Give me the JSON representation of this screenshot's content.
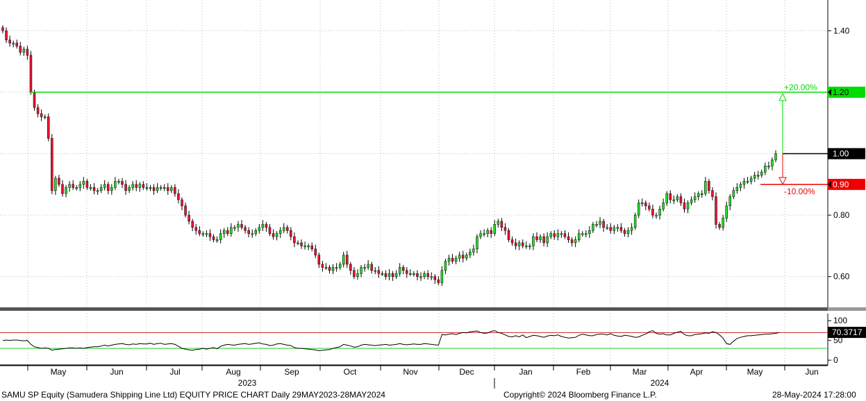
{
  "footer": {
    "left": "SAMU SP Equity (Samudera Shipping Line Ltd) EQUITY PRICE CHART  Daily 29MAY2023-28MAY2024",
    "center": "Copyright© 2024 Bloomberg Finance L.P.",
    "right": "28-May-2024 17:28:00"
  },
  "colors": {
    "up": "#22dd22",
    "down": "#ee1133",
    "target_up": "#00dd00",
    "target_down": "#ee0000",
    "rsi_line": "#000000"
  },
  "chart_data": [
    {
      "type": "candlestick",
      "ylim": [
        0.5,
        1.5
      ],
      "y_ticks": [
        0.6,
        0.8,
        1.0,
        1.2,
        1.4
      ],
      "y_tick_labels": [
        "0.60",
        "0.80",
        "1.00",
        "1.20",
        "1.40"
      ],
      "x_labels": [
        "May",
        "Jun",
        "Jul",
        "Aug",
        "Sep",
        "Oct",
        "Nov",
        "Dec",
        "Jan",
        "Feb",
        "Mar",
        "Apr",
        "May",
        "Jun"
      ],
      "year_labels": [
        "2023",
        "2024"
      ],
      "grid": true,
      "last_price": 1.0,
      "last_price_label": "1.00",
      "upper_target": {
        "value": 1.2,
        "label": "1.20",
        "pct_label": "+20.00%"
      },
      "lower_target": {
        "value": 0.9,
        "label": "0.90",
        "pct_label": "-10.00%"
      },
      "close": [
        1.4,
        1.37,
        1.36,
        1.36,
        1.35,
        1.33,
        1.34,
        1.32,
        1.2,
        1.15,
        1.13,
        1.12,
        1.12,
        1.05,
        0.88,
        0.92,
        0.9,
        0.87,
        0.89,
        0.9,
        0.89,
        0.89,
        0.9,
        0.91,
        0.89,
        0.89,
        0.88,
        0.88,
        0.89,
        0.9,
        0.88,
        0.89,
        0.91,
        0.91,
        0.9,
        0.88,
        0.89,
        0.9,
        0.89,
        0.9,
        0.89,
        0.89,
        0.89,
        0.88,
        0.89,
        0.89,
        0.89,
        0.88,
        0.89,
        0.87,
        0.85,
        0.83,
        0.8,
        0.78,
        0.76,
        0.75,
        0.74,
        0.74,
        0.74,
        0.73,
        0.72,
        0.72,
        0.74,
        0.75,
        0.74,
        0.76,
        0.76,
        0.77,
        0.76,
        0.75,
        0.74,
        0.74,
        0.75,
        0.76,
        0.77,
        0.76,
        0.74,
        0.73,
        0.74,
        0.75,
        0.76,
        0.75,
        0.73,
        0.71,
        0.71,
        0.7,
        0.7,
        0.7,
        0.69,
        0.67,
        0.64,
        0.63,
        0.63,
        0.62,
        0.63,
        0.63,
        0.64,
        0.67,
        0.64,
        0.62,
        0.6,
        0.61,
        0.63,
        0.63,
        0.64,
        0.62,
        0.62,
        0.61,
        0.61,
        0.6,
        0.61,
        0.6,
        0.61,
        0.63,
        0.62,
        0.61,
        0.61,
        0.61,
        0.6,
        0.6,
        0.61,
        0.6,
        0.6,
        0.59,
        0.58,
        0.62,
        0.65,
        0.66,
        0.65,
        0.66,
        0.67,
        0.66,
        0.67,
        0.68,
        0.69,
        0.73,
        0.74,
        0.74,
        0.75,
        0.74,
        0.77,
        0.78,
        0.76,
        0.75,
        0.72,
        0.71,
        0.7,
        0.71,
        0.7,
        0.7,
        0.7,
        0.73,
        0.72,
        0.73,
        0.71,
        0.73,
        0.74,
        0.73,
        0.74,
        0.74,
        0.73,
        0.72,
        0.71,
        0.72,
        0.74,
        0.74,
        0.74,
        0.75,
        0.77,
        0.77,
        0.78,
        0.76,
        0.76,
        0.75,
        0.76,
        0.76,
        0.75,
        0.74,
        0.75,
        0.76,
        0.8,
        0.84,
        0.84,
        0.83,
        0.82,
        0.8,
        0.8,
        0.82,
        0.84,
        0.87,
        0.85,
        0.85,
        0.86,
        0.84,
        0.82,
        0.84,
        0.85,
        0.86,
        0.87,
        0.87,
        0.91,
        0.88,
        0.86,
        0.77,
        0.76,
        0.79,
        0.83,
        0.86,
        0.88,
        0.89,
        0.9,
        0.91,
        0.91,
        0.92,
        0.93,
        0.93,
        0.94,
        0.96,
        0.96,
        0.98,
        1.0
      ]
    },
    {
      "type": "line",
      "ylim": [
        -12,
        118
      ],
      "y_ticks": [
        0,
        50,
        100
      ],
      "y_tick_labels": [
        "0",
        "50",
        "100"
      ],
      "bands": {
        "upper": 70,
        "lower": 30
      },
      "last_value": 70.3717,
      "last_value_label": "70.3717",
      "rsi": [
        50,
        51,
        50,
        51,
        51,
        50,
        49,
        50,
        40,
        34,
        32,
        30,
        31,
        30,
        25,
        27,
        28,
        29,
        30,
        31,
        31,
        30,
        31,
        30,
        32,
        33,
        34,
        34,
        36,
        38,
        36,
        38,
        40,
        41,
        42,
        40,
        39,
        41,
        40,
        42,
        41,
        41,
        43,
        40,
        42,
        43,
        40,
        41,
        42,
        40,
        35,
        30,
        28,
        26,
        25,
        27,
        28,
        30,
        28,
        30,
        32,
        29,
        35,
        38,
        40,
        39,
        38,
        40,
        41,
        42,
        40,
        41,
        43,
        44,
        41,
        40,
        37,
        38,
        41,
        42,
        40,
        38,
        37,
        32,
        30,
        30,
        29,
        28,
        27,
        26,
        24,
        25,
        26,
        27,
        30,
        32,
        34,
        40,
        38,
        36,
        33,
        34,
        38,
        40,
        39,
        38,
        37,
        38,
        39,
        40,
        38,
        39,
        40,
        42,
        40,
        39,
        40,
        41,
        40,
        40,
        42,
        41,
        40,
        39,
        38,
        65,
        64,
        66,
        67,
        65,
        68,
        70,
        69,
        72,
        73,
        74,
        70,
        68,
        69,
        73,
        75,
        70,
        68,
        64,
        60,
        59,
        62,
        59,
        64,
        57,
        60,
        63,
        62,
        60,
        58,
        61,
        63,
        62,
        64,
        60,
        58,
        56,
        57,
        58,
        63,
        66,
        64,
        62,
        62,
        65,
        66,
        66,
        64,
        67,
        63,
        61,
        60,
        63,
        62,
        60,
        58,
        59,
        63,
        66,
        72,
        75,
        68,
        66,
        67,
        64,
        64,
        68,
        71,
        73,
        65,
        62,
        62,
        65,
        66,
        67,
        69,
        68,
        72,
        70,
        64,
        56,
        42,
        40,
        48,
        55,
        58,
        60,
        62,
        62,
        63,
        64,
        65,
        66,
        66,
        67,
        68,
        70
      ]
    }
  ]
}
